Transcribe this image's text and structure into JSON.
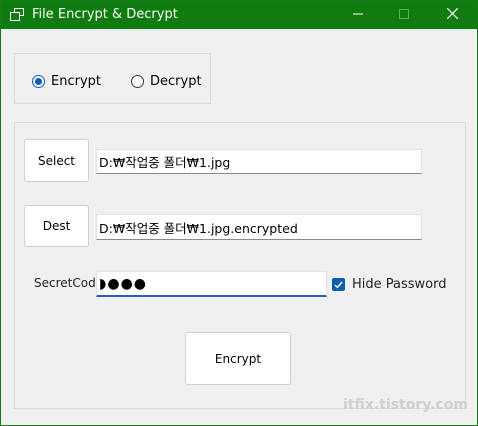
{
  "window": {
    "title": "File Encrypt & Decrypt",
    "icons": {
      "app": "window-icon",
      "minimize": "minimize-icon",
      "maximize": "maximize-icon",
      "close": "close-icon"
    }
  },
  "mode": {
    "options": [
      {
        "label": "Encrypt",
        "selected": true
      },
      {
        "label": "Decrypt",
        "selected": false
      }
    ]
  },
  "source": {
    "button_label": "Select",
    "path": "D:₩작업중 폴더₩1.jpg"
  },
  "destination": {
    "button_label": "Dest",
    "path": "D:₩작업중 폴더₩1.jpg.encrypted"
  },
  "secret": {
    "label": "SecretCode",
    "masked_value": "◗●●●"
  },
  "hide_password": {
    "label": "Hide Password",
    "checked": true
  },
  "action": {
    "button_label": "Encrypt"
  },
  "watermark": "itfix.tistory.com",
  "colors": {
    "titlebar": "#107c10",
    "accent": "#0b5fb3",
    "focus_underline": "#2f5fb0"
  }
}
